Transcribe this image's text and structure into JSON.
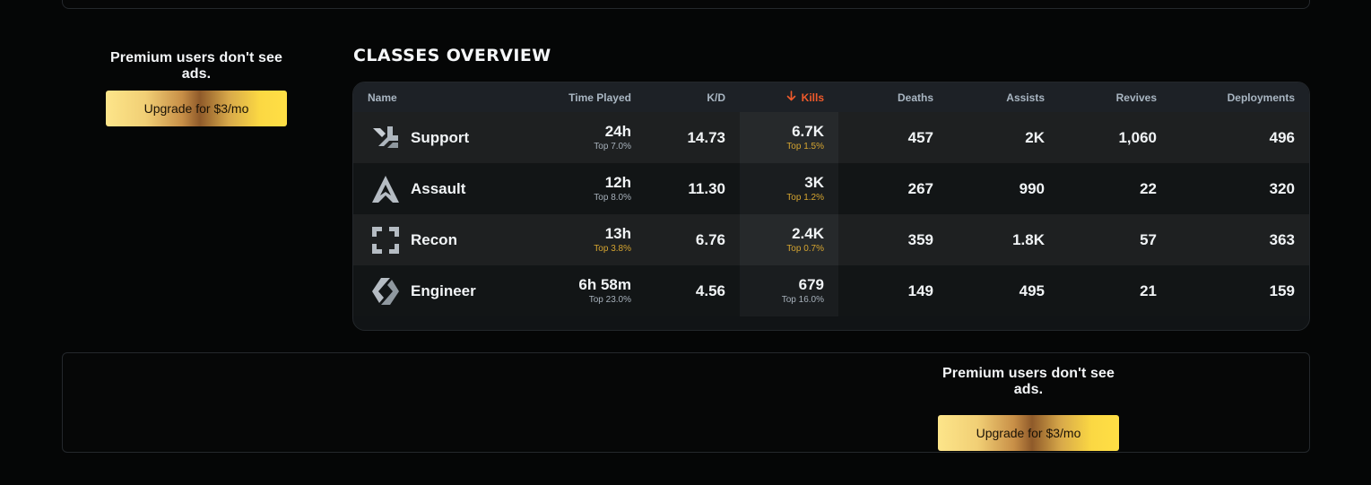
{
  "ads": {
    "left": {
      "text": "Premium users don't see ads.",
      "button_label": "Upgrade for $3/mo"
    },
    "bottom": {
      "text": "Premium users don't see ads.",
      "button_label": "Upgrade for $3/mo"
    }
  },
  "section": {
    "title": "CLASSES OVERVIEW"
  },
  "table": {
    "headers": {
      "name": "Name",
      "time_played": "Time Played",
      "kd": "K/D",
      "kills": "Kills",
      "deaths": "Deaths",
      "assists": "Assists",
      "revives": "Revives",
      "deployments": "Deployments"
    },
    "sort_icon": "arrow-down-icon",
    "rows": [
      {
        "icon": "support-class-icon",
        "name": "Support",
        "time_played": "24h",
        "time_rank": "Top 7.0%",
        "kd": "14.73",
        "kills": "6.7K",
        "kills_rank": "Top 1.5%",
        "deaths": "457",
        "assists": "2K",
        "revives": "1,060",
        "deployments": "496"
      },
      {
        "icon": "assault-class-icon",
        "name": "Assault",
        "time_played": "12h",
        "time_rank": "Top 8.0%",
        "kd": "11.30",
        "kills": "3K",
        "kills_rank": "Top 1.2%",
        "deaths": "267",
        "assists": "990",
        "revives": "22",
        "deployments": "320"
      },
      {
        "icon": "recon-class-icon",
        "name": "Recon",
        "time_played": "13h",
        "time_rank": "Top 3.8%",
        "kd": "6.76",
        "kills": "2.4K",
        "kills_rank": "Top 0.7%",
        "deaths": "359",
        "assists": "1.8K",
        "revives": "57",
        "deployments": "363"
      },
      {
        "icon": "engineer-class-icon",
        "name": "Engineer",
        "time_played": "6h 58m",
        "time_rank": "Top 23.0%",
        "kd": "4.56",
        "kills": "679",
        "kills_rank": "Top 16.0%",
        "deaths": "149",
        "assists": "495",
        "revives": "21",
        "deployments": "159"
      }
    ]
  },
  "colors": {
    "accent_sort": "#f05a2b",
    "rank_gold": "#d6a530",
    "rank_gray": "#a7b1bb"
  }
}
